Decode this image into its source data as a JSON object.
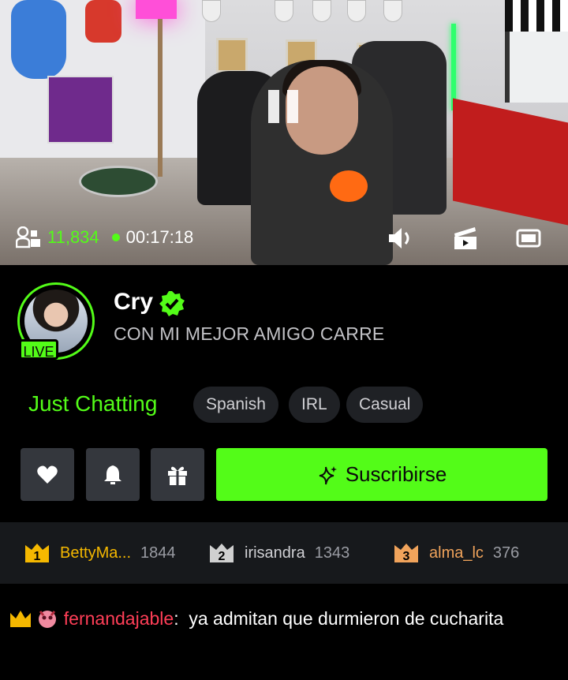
{
  "player": {
    "viewer_count": "11,834",
    "uptime": "00:17:18",
    "icons": [
      "viewers-icon",
      "pause-icon",
      "volume-icon",
      "clip-icon",
      "theater-mode-icon"
    ]
  },
  "channel": {
    "name": "Cry",
    "title": "CON MI MEJOR AMIGO CARRE",
    "live_label": "LIVE",
    "category": "Just Chatting",
    "tags": [
      "Spanish",
      "IRL",
      "Casual"
    ],
    "subscribe_label": "Suscribirse"
  },
  "leaderboard": [
    {
      "rank": "1",
      "name": "BettyMa...",
      "count": "1844",
      "color": "#f5b800"
    },
    {
      "rank": "2",
      "name": "irisandra",
      "count": "1343",
      "color": "#d0d0d0"
    },
    {
      "rank": "3",
      "name": "alma_lc",
      "count": "376",
      "color": "#f0a35b"
    }
  ],
  "chat": {
    "messages": [
      {
        "user": "fernandajable",
        "separator": ":",
        "text": "ya admitan que durmieron de cucharita"
      }
    ]
  },
  "colors": {
    "accent": "#53fc18",
    "background": "#000000",
    "panel": "#17191c",
    "chat_user": "#ff3e57"
  }
}
